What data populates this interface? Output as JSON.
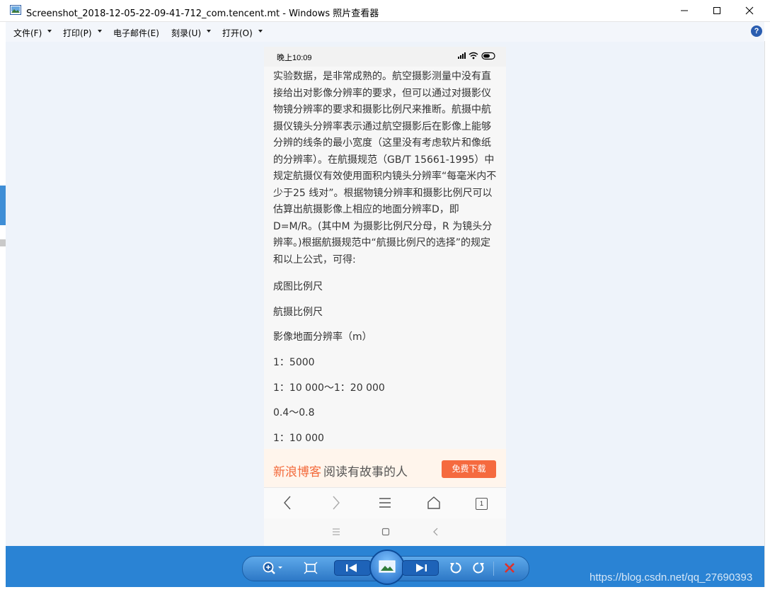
{
  "window": {
    "title": "Screenshot_2018-12-05-22-09-41-712_com.tencent.mt - Windows 照片查看器"
  },
  "menu": {
    "items": [
      {
        "label": "文件(F)"
      },
      {
        "label": "打印(P)"
      },
      {
        "label": "电子邮件(E)"
      },
      {
        "label": "刻录(U)"
      },
      {
        "label": "打开(O)"
      }
    ],
    "help_label": "?"
  },
  "phone": {
    "status_time": "晚上10:09",
    "article_text": "实验数据，是非常成熟的。航空摄影测量中没有直接给出对影像分辨率的要求，但可以通过对摄影仪物镜分辨率的要求和摄影比例尺来推断。航摄中航摄仪镜头分辨率表示通过航空摄影后在影像上能够分辨的线条的最小宽度（这里没有考虑软片和像纸的分辨率）。在航摄规范（GB/T 15661-1995）中规定航摄仪有效使用面积内镜头分辨率“每毫米内不少于25 线对”。根据物镜分辨率和摄影比例尺可以估算出航摄影像上相应的地面分辨率D，即D=M/R。(其中M 为摄影比例尺分母，R 为镜头分辨率。)根据航摄规范中“航摄比例尺的选择”的规定和以上公式，可得:",
    "paragraphs": [
      "成图比例尺",
      "航摄比例尺",
      "影像地面分辨率（m）",
      "1：5000",
      "1：10 000～1：20 000",
      "0.4～0.8",
      "1：10 000"
    ],
    "ad": {
      "brand": "新浪博客",
      "slogan": "阅读有故事的人",
      "button": "免费下载"
    },
    "tab_count": "1"
  },
  "watermark": "https://blog.csdn.net/qq_27690393",
  "colors": {
    "toolbar": "#2a83d4",
    "accent_orange": "#f56a3f",
    "delete_red": "#e0302a"
  }
}
